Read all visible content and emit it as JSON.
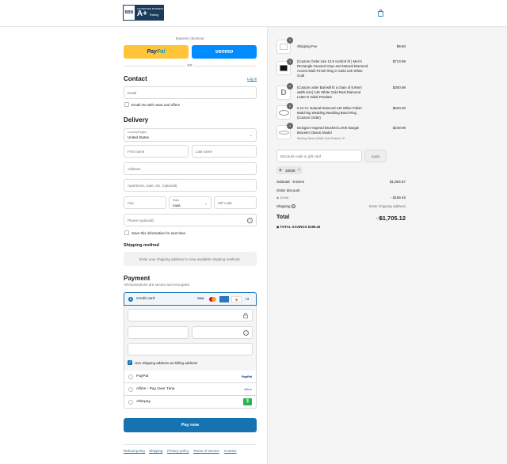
{
  "header": {
    "logo": {
      "seal": "BBB",
      "line1": "ACCREDITED BUSINESS",
      "grade": "A+",
      "rating": "Rating"
    },
    "cart_icon": "shopping-bag-icon"
  },
  "express": {
    "title": "Express checkout",
    "paypal": {
      "pay": "Pay",
      "pal": "Pal"
    },
    "venmo": "venmo",
    "or": "OR"
  },
  "contact": {
    "heading": "Contact",
    "login": "Log in",
    "email_placeholder": "Email",
    "news_label": "Email me with news and offers"
  },
  "delivery": {
    "heading": "Delivery",
    "country_label": "Country/Region",
    "country_value": "United States",
    "first_name": "First name",
    "last_name": "Last name",
    "address": "Address",
    "apartment": "Apartment, suite, etc. (optional)",
    "city": "City",
    "state_label": "State",
    "state_value": "Iowa",
    "zip": "ZIP code",
    "phone": "Phone (optional)",
    "save_label": "Save this information for next time"
  },
  "shipping_method": {
    "heading": "Shipping method",
    "message": "Enter your shipping address to view available shipping methods."
  },
  "payment": {
    "heading": "Payment",
    "subtitle": "All transactions are secure and encrypted.",
    "credit_card": "Credit card",
    "cards": [
      "VISA",
      "MC",
      "AMEX",
      "DISCOVER"
    ],
    "more": "+3",
    "billing_label": "Use shipping address as billing address",
    "paypal": "PayPal",
    "paypal_logo": "PayPal",
    "affirm": "Affirm - Pay Over Time",
    "affirm_logo": "affirm",
    "afterpay": "Afterpay",
    "afterpay_logo": "$",
    "pay_now": "Pay now"
  },
  "footer_links": [
    "Refund policy",
    "Shipping",
    "Privacy policy",
    "Terms of service",
    "Contact"
  ],
  "summary": {
    "items": [
      {
        "qty": "1",
        "name": "Shipping Fee",
        "price": "$9.60"
      },
      {
        "qty": "1",
        "name": "(Custom Order size 12.5 comfort fit ) Men's Rectangle Faceted Onyx and Natural Diamond Accent Multi-Finish Ring in Solid 10K White Gold",
        "price": "$713.99"
      },
      {
        "qty": "1",
        "name": "(Custom order Bail will fit a chain of 6.9mm width size) 14K White Gold Real Diamond Letter D Initial Pendant",
        "price": "$300.99"
      },
      {
        "qty": "1",
        "name": "0.12 Ct. Natural Diamond 14k White Polish Matching Wedding Wedding Band Ring (Custom Order)",
        "price": "$620.00"
      },
      {
        "qty": "1",
        "name": "Designer Inspired Brushed LOVE Bangle Bracelet Classic Model",
        "price": "$249.99",
        "variant": "Sterling Silver (White Gold Plated) / 6\""
      }
    ],
    "discount_placeholder": "Discount code or gift card",
    "apply": "Apply",
    "code": "10036",
    "subtotal_label": "Subtotal · 5 items",
    "subtotal": "$1,894.57",
    "order_discount_label": "Order discount",
    "discount_code": "10036",
    "discount_value": "- $189.45",
    "shipping_label": "Shipping",
    "shipping_value": "Enter shipping address",
    "total_label": "Total",
    "currency": "USD",
    "total": "$1,705.12",
    "savings_label": "TOTAL SAVINGS",
    "savings": "$189.45"
  }
}
